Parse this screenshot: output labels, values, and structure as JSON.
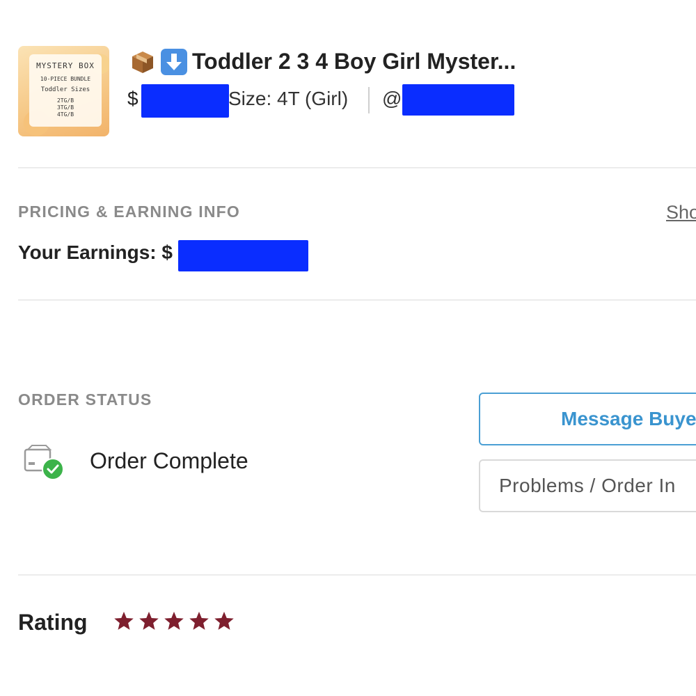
{
  "product": {
    "thumbnail": {
      "line1": "MYSTERY BOX",
      "line2": "10-PIECE BUNDLE",
      "line3": "Toddler Sizes",
      "sizes": [
        "2TG/B",
        "3TG/B",
        "4TG/B"
      ]
    },
    "emoji_icons": [
      "package-icon",
      "down-arrow-icon"
    ],
    "title": "Toddler 2 3 4 Boy Girl Myster...",
    "currency_symbol": "$",
    "size": "Size: 4T (Girl)",
    "at_symbol": "@"
  },
  "pricing": {
    "section_title": "PRICING & EARNING INFO",
    "show_link": "Sho",
    "earnings_label": "Your Earnings: $"
  },
  "order_status": {
    "section_title": "ORDER STATUS",
    "status": "Order Complete",
    "message_button": "Message Buye",
    "problems_button": "Problems / Order In"
  },
  "rating": {
    "label": "Rating",
    "stars": 5,
    "star_color": "#7e1f2e"
  },
  "colors": {
    "redaction": "#0a2dff",
    "accent": "#3a94cf",
    "success": "#3cb34a"
  }
}
